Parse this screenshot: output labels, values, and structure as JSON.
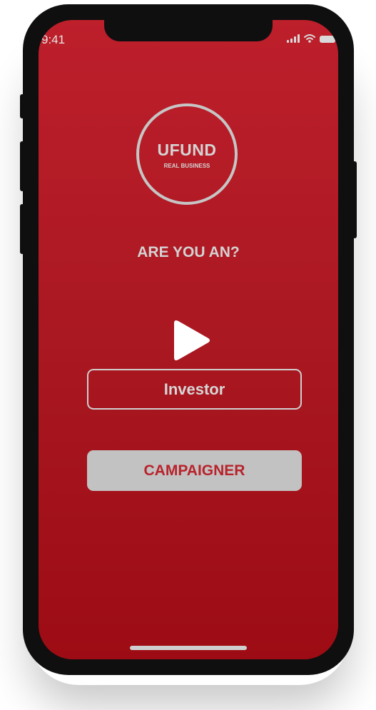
{
  "status_bar": {
    "time": "9:41"
  },
  "logo": {
    "title": "UFUND",
    "subtitle": "REAL BUSINESS"
  },
  "question": "ARE YOU AN?",
  "buttons": {
    "investor": "Investor",
    "campaigner": "CAMPAIGNER"
  },
  "colors": {
    "background_top": "#bd1f2b",
    "background_bottom": "#9d0c14",
    "light_grey": "#c2c2c2",
    "accent_red": "#b8232c"
  },
  "icons": [
    "play-icon",
    "signal-icon",
    "wifi-icon",
    "battery-icon"
  ]
}
